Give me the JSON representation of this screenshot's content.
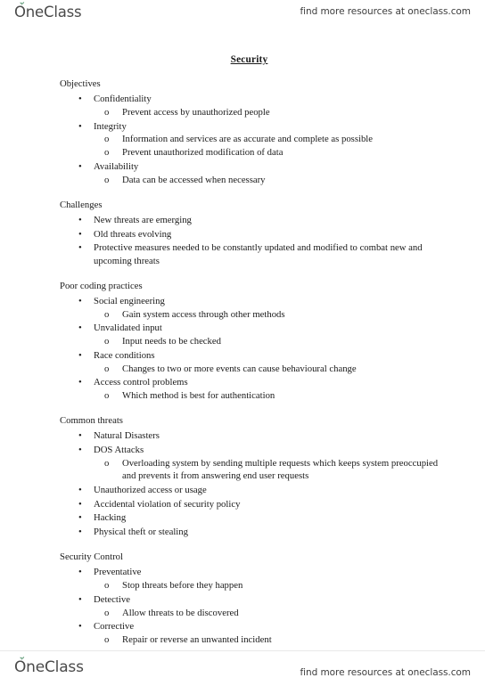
{
  "header": {
    "logo_text": "OneClass",
    "logo_icon": "leaf-sprout-icon",
    "tagline": "find more resources at oneclass.com"
  },
  "footer": {
    "logo_text": "OneClass",
    "logo_icon": "leaf-sprout-icon",
    "tagline": "find more resources at oneclass.com"
  },
  "document": {
    "title": "Security",
    "markers": {
      "level1": "•",
      "level2": "o"
    },
    "sections": [
      {
        "heading": "Objectives",
        "items": [
          {
            "text": "Confidentiality",
            "sub": [
              "Prevent access by unauthorized people"
            ]
          },
          {
            "text": "Integrity",
            "sub": [
              "Information and services are as accurate and complete as possible",
              "Prevent unauthorized modification of data"
            ]
          },
          {
            "text": "Availability",
            "sub": [
              "Data can be accessed when necessary"
            ]
          }
        ]
      },
      {
        "heading": "Challenges",
        "items": [
          {
            "text": "New threats are emerging",
            "sub": []
          },
          {
            "text": "Old threats evolving",
            "sub": []
          },
          {
            "text": "Protective measures needed to be constantly updated and modified to combat new and upcoming threats",
            "sub": []
          }
        ]
      },
      {
        "heading": "Poor coding practices",
        "items": [
          {
            "text": "Social engineering",
            "sub": [
              "Gain system access through other methods"
            ]
          },
          {
            "text": "Unvalidated input",
            "sub": [
              "Input needs to be checked"
            ]
          },
          {
            "text": "Race conditions",
            "sub": [
              "Changes to two or more events can cause behavioural change"
            ]
          },
          {
            "text": "Access control problems",
            "sub": [
              "Which method is best for authentication"
            ]
          }
        ]
      },
      {
        "heading": "Common threats",
        "items": [
          {
            "text": "Natural Disasters",
            "sub": []
          },
          {
            "text": "DOS Attacks",
            "sub": [
              "Overloading system by sending multiple requests which keeps system preoccupied and prevents it from answering end user requests"
            ]
          },
          {
            "text": "Unauthorized access or usage",
            "sub": []
          },
          {
            "text": "Accidental violation of security policy",
            "sub": []
          },
          {
            "text": "Hacking",
            "sub": []
          },
          {
            "text": "Physical theft or stealing",
            "sub": []
          }
        ]
      },
      {
        "heading": "Security Control",
        "items": [
          {
            "text": "Preventative",
            "sub": [
              "Stop threats before they happen"
            ]
          },
          {
            "text": "Detective",
            "sub": [
              "Allow threats to be discovered"
            ]
          },
          {
            "text": "Corrective",
            "sub": [
              "Repair or reverse an unwanted incident"
            ]
          }
        ]
      }
    ]
  },
  "colors": {
    "leaf_green": "#2e7d4f",
    "logo_gray": "#4a4a4a",
    "text": "#1a1a1a",
    "rule": "#e8e8e8"
  }
}
